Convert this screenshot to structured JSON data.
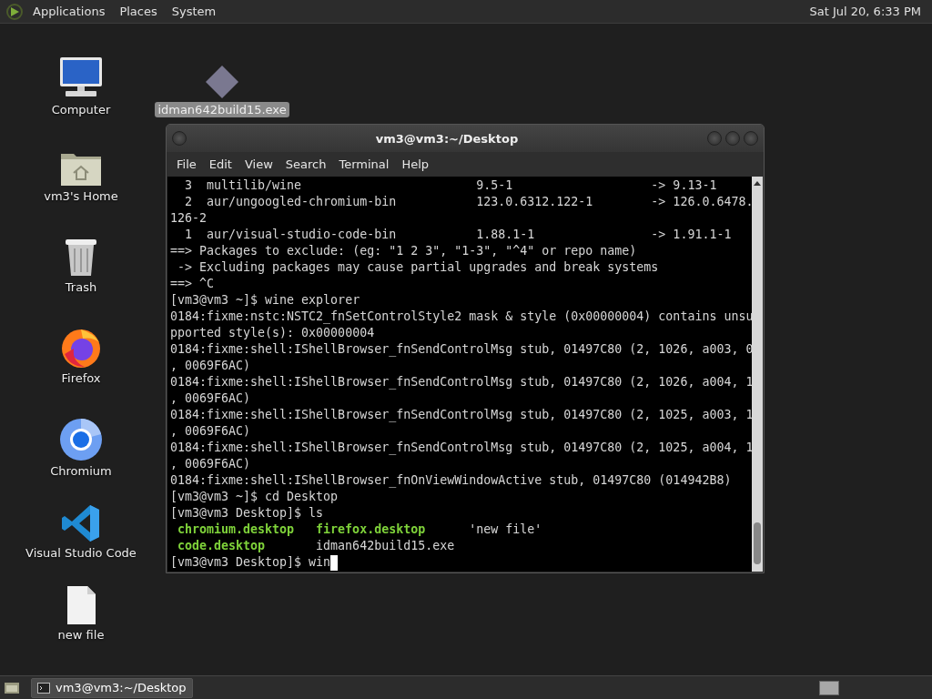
{
  "top_panel": {
    "menus": [
      "Applications",
      "Places",
      "System"
    ],
    "clock": "Sat Jul 20, 6:33 PM"
  },
  "desktop_icons": [
    {
      "label": "Computer",
      "kind": "computer",
      "selected": false
    },
    {
      "label": "vm3's Home",
      "kind": "home",
      "selected": false
    },
    {
      "label": "Trash",
      "kind": "trash",
      "selected": false
    },
    {
      "label": "Firefox",
      "kind": "firefox",
      "selected": false
    },
    {
      "label": "Chromium",
      "kind": "chromium",
      "selected": false
    },
    {
      "label": "Visual Studio Code",
      "kind": "vscode",
      "selected": false
    },
    {
      "label": "new file",
      "kind": "file",
      "selected": false
    },
    {
      "label": "idman642build15.exe",
      "kind": "exe",
      "selected": true
    }
  ],
  "terminal": {
    "title": "vm3@vm3:~/Desktop",
    "menu": [
      "File",
      "Edit",
      "View",
      "Search",
      "Terminal",
      "Help"
    ],
    "lines": [
      {
        "kind": "text",
        "text": "  3  multilib/wine                        9.5-1                   -> 9.13-1"
      },
      {
        "kind": "text",
        "text": "  2  aur/ungoogled-chromium-bin           123.0.6312.122-1        -> 126.0.6478."
      },
      {
        "kind": "text",
        "text": "126-2"
      },
      {
        "kind": "text",
        "text": "  1  aur/visual-studio-code-bin           1.88.1-1                -> 1.91.1-1"
      },
      {
        "kind": "text",
        "text": "==> Packages to exclude: (eg: \"1 2 3\", \"1-3\", \"^4\" or repo name)"
      },
      {
        "kind": "text",
        "text": " -> Excluding packages may cause partial upgrades and break systems"
      },
      {
        "kind": "text",
        "text": "==> ^C"
      },
      {
        "kind": "text",
        "text": "[vm3@vm3 ~]$ wine explorer"
      },
      {
        "kind": "text",
        "text": "0184:fixme:nstc:NSTC2_fnSetControlStyle2 mask & style (0x00000004) contains unsu"
      },
      {
        "kind": "text",
        "text": "pported style(s): 0x00000004"
      },
      {
        "kind": "text",
        "text": "0184:fixme:shell:IShellBrowser_fnSendControlMsg stub, 01497C80 (2, 1026, a003, 0"
      },
      {
        "kind": "text",
        "text": ", 0069F6AC)"
      },
      {
        "kind": "text",
        "text": "0184:fixme:shell:IShellBrowser_fnSendControlMsg stub, 01497C80 (2, 1026, a004, 1"
      },
      {
        "kind": "text",
        "text": ", 0069F6AC)"
      },
      {
        "kind": "text",
        "text": "0184:fixme:shell:IShellBrowser_fnSendControlMsg stub, 01497C80 (2, 1025, a003, 1"
      },
      {
        "kind": "text",
        "text": ", 0069F6AC)"
      },
      {
        "kind": "text",
        "text": "0184:fixme:shell:IShellBrowser_fnSendControlMsg stub, 01497C80 (2, 1025, a004, 1"
      },
      {
        "kind": "text",
        "text": ", 0069F6AC)"
      },
      {
        "kind": "text",
        "text": "0184:fixme:shell:IShellBrowser_fnOnViewWindowActive stub, 01497C80 (014942B8)"
      },
      {
        "kind": "text",
        "text": "[vm3@vm3 ~]$ cd Desktop"
      },
      {
        "kind": "text",
        "text": "[vm3@vm3 Desktop]$ ls"
      },
      {
        "kind": "listing",
        "entries": [
          {
            "text": "chromium.desktop",
            "kind": "desktop-file"
          },
          {
            "text": "firefox.desktop",
            "kind": "desktop-file"
          },
          {
            "text": "'new file'",
            "kind": "plain"
          }
        ]
      },
      {
        "kind": "listing",
        "entries": [
          {
            "text": "code.desktop",
            "kind": "desktop-file"
          },
          {
            "text": "idman642build15.exe",
            "kind": "plain"
          }
        ]
      },
      {
        "kind": "input",
        "text": "[vm3@vm3 Desktop]$ win"
      }
    ]
  },
  "taskbar": {
    "tasks": [
      {
        "label": "vm3@vm3:~/Desktop",
        "selected": true
      }
    ]
  }
}
